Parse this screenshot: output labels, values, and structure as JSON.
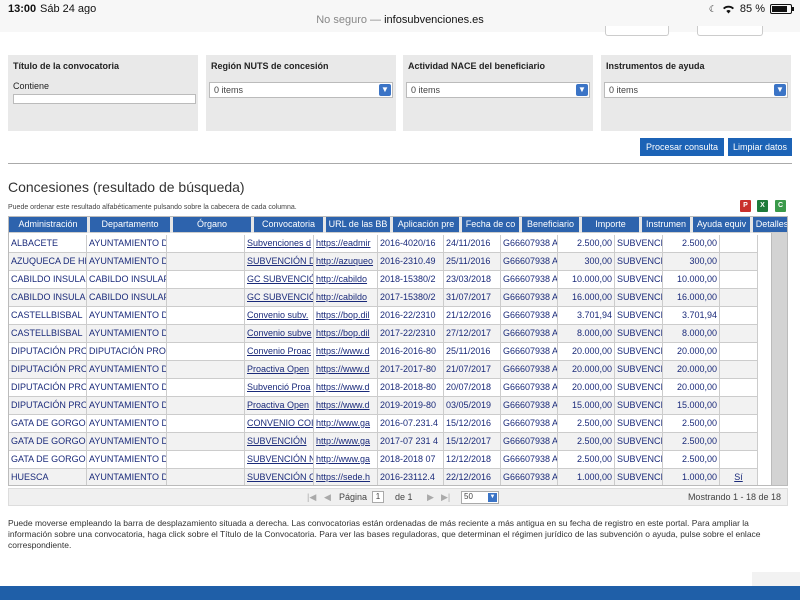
{
  "status_bar": {
    "time": "13:00",
    "date": "Sáb 24 ago",
    "battery": "85 %",
    "battery_level": 0.85
  },
  "address_bar": {
    "security": "No seguro —",
    "domain": "infosubvenciones.es"
  },
  "filters": {
    "titulo": {
      "title": "Título de la convocatoria",
      "label": "Contiene",
      "value": ""
    },
    "region": {
      "title": "Región NUTS de concesión",
      "selected": "0 items"
    },
    "actividad": {
      "title": "Actividad NACE del beneficiario",
      "selected": "0 items"
    },
    "instrumentos": {
      "title": "Instrumentos de ayuda",
      "selected": "0 items"
    }
  },
  "buttons": {
    "procesar": "Procesar consulta",
    "limpiar": "Limpiar datos"
  },
  "results": {
    "heading": "Concesiones (resultado de búsqueda)",
    "hint": "Puede ordenar este resultado alfabéticamente pulsando sobre la cabecera de cada columna.",
    "export_icons": [
      "pdf-export-icon",
      "excel-export-icon",
      "csv-export-icon"
    ]
  },
  "table": {
    "columns": [
      "Administración",
      "Departamento",
      "Órgano",
      "Convocatoria",
      "URL de las BB",
      "Aplicación pre",
      "Fecha de co",
      "Beneficiario",
      "Importe",
      "Instrumen",
      "Ayuda equiv",
      "Detalles"
    ],
    "rows": [
      [
        "ALBACETE",
        "AYUNTAMIENTO D",
        "",
        "Subvenciones d",
        "https://eadmir",
        "2016-4020/16",
        "24/11/2016",
        "G66607938 A",
        "2.500,00",
        "SUBVENCIÓ",
        "2.500,00",
        ""
      ],
      [
        "AZUQUECA DE HE",
        "AYUNTAMIENTO D",
        "",
        "SUBVENCIÓN D",
        "http://azuqueo",
        "2016-2310.49",
        "25/11/2016",
        "G66607938 A",
        "300,00",
        "SUBVENCIÓ",
        "300,00",
        ""
      ],
      [
        "CABILDO INSULAI",
        "CABILDO INSULAF",
        "",
        "GC SUBVENCIÓ",
        "http://cabildo",
        "2018-15380/2",
        "23/03/2018",
        "G66607938 A",
        "10.000,00",
        "SUBVENCIÓ",
        "10.000,00",
        ""
      ],
      [
        "CABILDO INSULAI",
        "CABILDO INSULAF",
        "",
        "GC SUBVENCIÓ",
        "http://cabildo",
        "2017-15380/2",
        "31/07/2017",
        "G66607938 A",
        "16.000,00",
        "SUBVENCIÓ",
        "16.000,00",
        ""
      ],
      [
        "CASTELLBISBAL",
        "AYUNTAMIENTO D",
        "",
        "Convenio subv.",
        "https://bop.dil",
        "2016-22/2310",
        "21/12/2016",
        "G66607938 A",
        "3.701,94",
        "SUBVENCIÓ",
        "3.701,94",
        ""
      ],
      [
        "CASTELLBISBAL",
        "AYUNTAMIENTO D",
        "",
        "Convenio subve",
        "https://bop.dil",
        "2017-22/2310",
        "27/12/2017",
        "G66607938 A",
        "8.000,00",
        "SUBVENCIÓ",
        "8.000,00",
        ""
      ],
      [
        "DIPUTACIÓN PROV",
        "DIPUTACIÓN PROV",
        "",
        "Convenio Proac",
        "https://www.d",
        "2016-2016-80",
        "25/11/2016",
        "G66607938 A",
        "20.000,00",
        "SUBVENCIÓ",
        "20.000,00",
        ""
      ],
      [
        "DIPUTACIÓN PROV",
        "AYUNTAMIENTO D",
        "",
        "Proactiva Open",
        "https://www.d",
        "2017-2017-80",
        "21/07/2017",
        "G66607938 A",
        "20.000,00",
        "SUBVENCIÓ",
        "20.000,00",
        ""
      ],
      [
        "DIPUTACIÓN PROV",
        "AYUNTAMIENTO D",
        "",
        "Subvenció Proa",
        "https://www.d",
        "2018-2018-80",
        "20/07/2018",
        "G66607938 A",
        "20.000,00",
        "SUBVENCIÓ",
        "20.000,00",
        ""
      ],
      [
        "DIPUTACIÓN PROV",
        "AYUNTAMIENTO D",
        "",
        "Proactiva Open",
        "https://www.d",
        "2019-2019-80",
        "03/05/2019",
        "G66607938 A",
        "15.000,00",
        "SUBVENCIÓ",
        "15.000,00",
        ""
      ],
      [
        "GATA DE GORGOS",
        "AYUNTAMIENTO D",
        "",
        "CONVENIO COI",
        "http://www.ga",
        "2016-07.231.4",
        "15/12/2016",
        "G66607938 A",
        "2.500,00",
        "SUBVENCIÓ",
        "2.500,00",
        ""
      ],
      [
        "GATA DE GORGOS",
        "AYUNTAMIENTO D",
        "",
        "SUBVENCIÓN",
        "http://www.ga",
        "2017-07 231 4",
        "15/12/2017",
        "G66607938 A",
        "2.500,00",
        "SUBVENCIÓ",
        "2.500,00",
        ""
      ],
      [
        "GATA DE GORGOS",
        "AYUNTAMIENTO D",
        "",
        "SUBVENCIÓN N",
        "http://www.ga",
        "2018-2018 07",
        "12/12/2018",
        "G66607938 A",
        "2.500,00",
        "SUBVENCIÓ",
        "2.500,00",
        ""
      ],
      [
        "HUESCA",
        "AYUNTAMIENTO D",
        "",
        "SUBVENCIÓN C",
        "https://sede.h",
        "2016-23112.4",
        "22/12/2016",
        "G66607938 A",
        "1.000,00",
        "SUBVENCIÓ",
        "1.000,00",
        "Sí"
      ]
    ]
  },
  "pager": {
    "page_label": "Página",
    "page": "1",
    "of": "de 1",
    "page_size": "50",
    "showing": "Mostrando 1 - 18 de 18"
  },
  "footer_text": "Puede moverse empleando la barra de desplazamiento situada a derecha. Las convocatorias están ordenadas de más reciente a más antigua en su fecha de registro en este portal. Para ampliar la información sobre una convocatoria, haga click sobre el Título de la Convocatoria. Para ver las bases reguladoras, que determinan el régimen jurídico de las subvención o ayuda, pulse sobre el enlace correspondiente."
}
